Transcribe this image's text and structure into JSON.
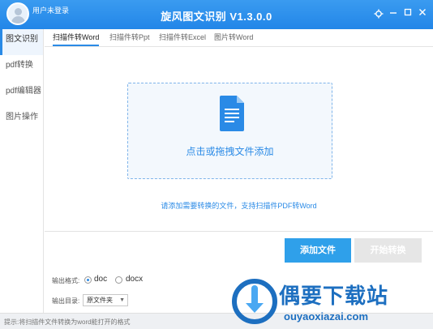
{
  "header": {
    "user_label": "用户未登录",
    "title": "旋风图文识别 V1.3.0.0",
    "settings_icon": "gear-icon",
    "minimize_icon": "minimize-icon",
    "maximize_icon": "maximize-icon",
    "close_icon": "close-icon"
  },
  "sidebar": {
    "items": [
      {
        "label": "图文识别",
        "active": true
      },
      {
        "label": "pdf转换"
      },
      {
        "label": "pdf编辑器"
      },
      {
        "label": "图片操作"
      }
    ]
  },
  "tabs": [
    {
      "label": "扫描件转Word",
      "active": true
    },
    {
      "label": "扫描件转Ppt"
    },
    {
      "label": "扫描件转Excel"
    },
    {
      "label": "图片转Word"
    }
  ],
  "dropzone": {
    "icon": "document-icon",
    "label": "点击或拖拽文件添加"
  },
  "hint": "请添加需要转换的文件，支持扫描件PDF转Word",
  "buttons": {
    "add": "添加文件",
    "start": "开始转换"
  },
  "output_format": {
    "label": "输出格式:",
    "options": [
      "doc",
      "docx"
    ],
    "selected": "doc"
  },
  "output_dir": {
    "label": "输出目录:",
    "value": "原文件夹"
  },
  "status": "提示:将扫描件文件转换为word能打开的格式",
  "watermark": {
    "title": "偶要下载站",
    "url": "ouyaoxiazai.com"
  },
  "colors": {
    "accent": "#2a8ae6",
    "titlebar": "#2286e8",
    "watermark": "#1d6fc0"
  }
}
